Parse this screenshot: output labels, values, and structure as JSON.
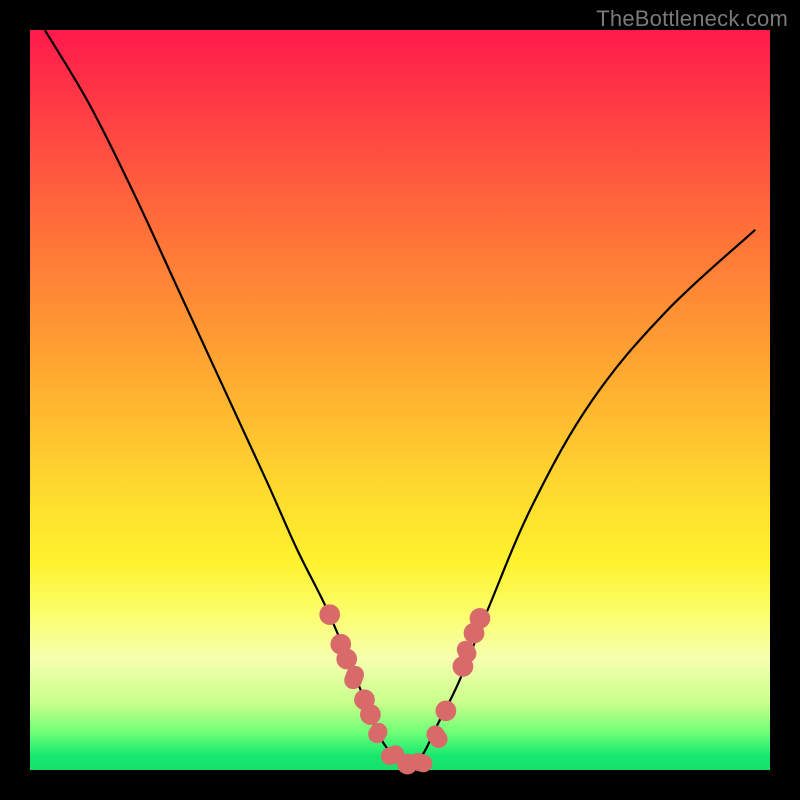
{
  "watermark": "TheBottleneck.com",
  "chart_data": {
    "type": "line",
    "title": "",
    "xlabel": "",
    "ylabel": "",
    "xlim": [
      0,
      100
    ],
    "ylim": [
      0,
      100
    ],
    "series": [
      {
        "name": "curve",
        "x": [
          2,
          8,
          14,
          20,
          26,
          32,
          36,
          40,
          43,
          45,
          47,
          49,
          51,
          53,
          55,
          58,
          62,
          68,
          76,
          86,
          98
        ],
        "y": [
          100,
          90,
          78,
          65,
          52,
          39,
          30,
          22,
          15,
          10,
          5,
          2,
          0.5,
          2,
          6,
          12,
          22,
          36,
          50,
          62,
          73
        ]
      }
    ],
    "markers": [
      {
        "shape": "dot",
        "x": 40.5,
        "y": 21,
        "r": 1.4
      },
      {
        "shape": "dot",
        "x": 42.0,
        "y": 17,
        "r": 1.4
      },
      {
        "shape": "dot",
        "x": 42.8,
        "y": 15,
        "r": 1.4
      },
      {
        "shape": "pill",
        "x": 43.8,
        "y": 12.5,
        "len": 3.2,
        "angle": -70
      },
      {
        "shape": "dot",
        "x": 45.2,
        "y": 9.5,
        "r": 1.4
      },
      {
        "shape": "dot",
        "x": 46.0,
        "y": 7.5,
        "r": 1.4
      },
      {
        "shape": "pill",
        "x": 47.0,
        "y": 5.0,
        "len": 2.8,
        "angle": -60
      },
      {
        "shape": "pill",
        "x": 49.0,
        "y": 2.0,
        "len": 3.2,
        "angle": -20
      },
      {
        "shape": "dot",
        "x": 51.0,
        "y": 0.8,
        "r": 1.4
      },
      {
        "shape": "pill",
        "x": 52.8,
        "y": 1.0,
        "len": 3.2,
        "angle": 15
      },
      {
        "shape": "pill",
        "x": 55.0,
        "y": 4.5,
        "len": 3.2,
        "angle": 55
      },
      {
        "shape": "dot",
        "x": 56.2,
        "y": 8.0,
        "r": 1.4
      },
      {
        "shape": "dot",
        "x": 58.5,
        "y": 14.0,
        "r": 1.4
      },
      {
        "shape": "pill",
        "x": 59.0,
        "y": 16.0,
        "len": 3.0,
        "angle": 65
      },
      {
        "shape": "dot",
        "x": 60.0,
        "y": 18.5,
        "r": 1.4
      },
      {
        "shape": "dot",
        "x": 60.8,
        "y": 20.5,
        "r": 1.4
      }
    ],
    "background": {
      "type": "vertical-gradient",
      "stops": [
        {
          "pos": 0,
          "color": "#ff1a4b"
        },
        {
          "pos": 50,
          "color": "#ffc531"
        },
        {
          "pos": 80,
          "color": "#fcff7a"
        },
        {
          "pos": 100,
          "color": "#15e06c"
        }
      ]
    }
  }
}
